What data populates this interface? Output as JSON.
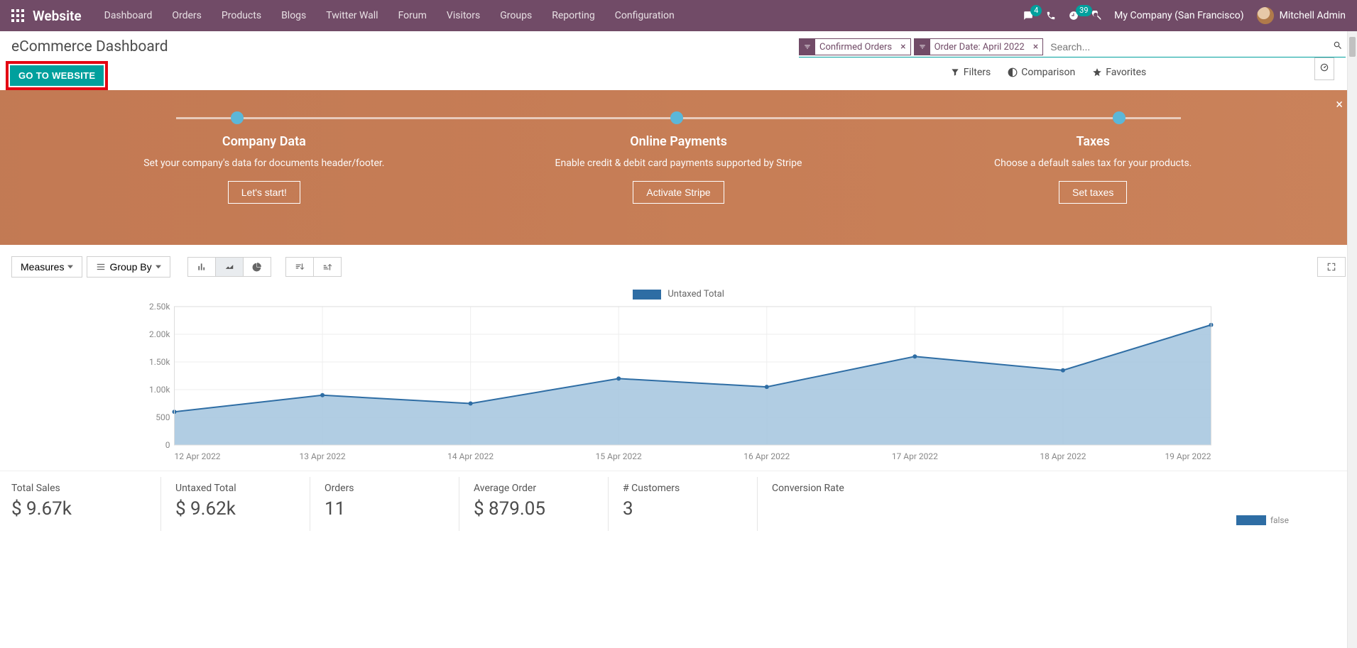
{
  "colors": {
    "primary": "#714b67",
    "teal": "#00a09d",
    "chart_line": "#2e6da4",
    "chart_fill": "#a8c8e0",
    "highlight": "#e30613"
  },
  "navbar": {
    "brand": "Website",
    "menu": [
      "Dashboard",
      "Orders",
      "Products",
      "Blogs",
      "Twitter Wall",
      "Forum",
      "Visitors",
      "Groups",
      "Reporting",
      "Configuration"
    ],
    "messages_badge": "4",
    "activities_badge": "39",
    "company": "My Company (San Francisco)",
    "user": "Mitchell Admin"
  },
  "control": {
    "title": "eCommerce Dashboard",
    "go_website": "GO TO WEBSITE",
    "facets": [
      {
        "label": "Confirmed Orders"
      },
      {
        "label": "Order Date: April 2022"
      }
    ],
    "search_placeholder": "Search...",
    "filters_label": "Filters",
    "comparison_label": "Comparison",
    "favorites_label": "Favorites"
  },
  "onboard": {
    "steps": [
      {
        "title": "Company Data",
        "desc": "Set your company's data for documents header/footer.",
        "btn": "Let's start!"
      },
      {
        "title": "Online Payments",
        "desc": "Enable credit & debit card payments supported by Stripe",
        "btn": "Activate Stripe"
      },
      {
        "title": "Taxes",
        "desc": "Choose a default sales tax for your products.",
        "btn": "Set taxes"
      }
    ]
  },
  "graph_toolbar": {
    "measures": "Measures",
    "group_by": "Group By"
  },
  "chart_data": {
    "type": "area",
    "title": "",
    "legend": "Untaxed Total",
    "xlabel": "",
    "ylabel": "",
    "ylim": [
      0,
      2500
    ],
    "yticks": [
      0,
      500,
      1000,
      1500,
      2000,
      2500
    ],
    "ytick_labels": [
      "0",
      "500",
      "1.00k",
      "1.50k",
      "2.00k",
      "2.50k"
    ],
    "categories": [
      "12 Apr 2022",
      "13 Apr 2022",
      "14 Apr 2022",
      "15 Apr 2022",
      "16 Apr 2022",
      "17 Apr 2022",
      "18 Apr 2022",
      "19 Apr 2022"
    ],
    "series": [
      {
        "name": "Untaxed Total",
        "values": [
          600,
          900,
          750,
          1200,
          1050,
          1600,
          1350,
          2170
        ]
      }
    ]
  },
  "kpis": [
    {
      "label": "Total Sales",
      "value": "$ 9.67k"
    },
    {
      "label": "Untaxed Total",
      "value": "$ 9.62k"
    },
    {
      "label": "Orders",
      "value": "11"
    },
    {
      "label": "Average Order",
      "value": "$ 879.05"
    },
    {
      "label": "# Customers",
      "value": "3"
    }
  ],
  "conversion": {
    "label": "Conversion Rate",
    "legend": "false"
  }
}
